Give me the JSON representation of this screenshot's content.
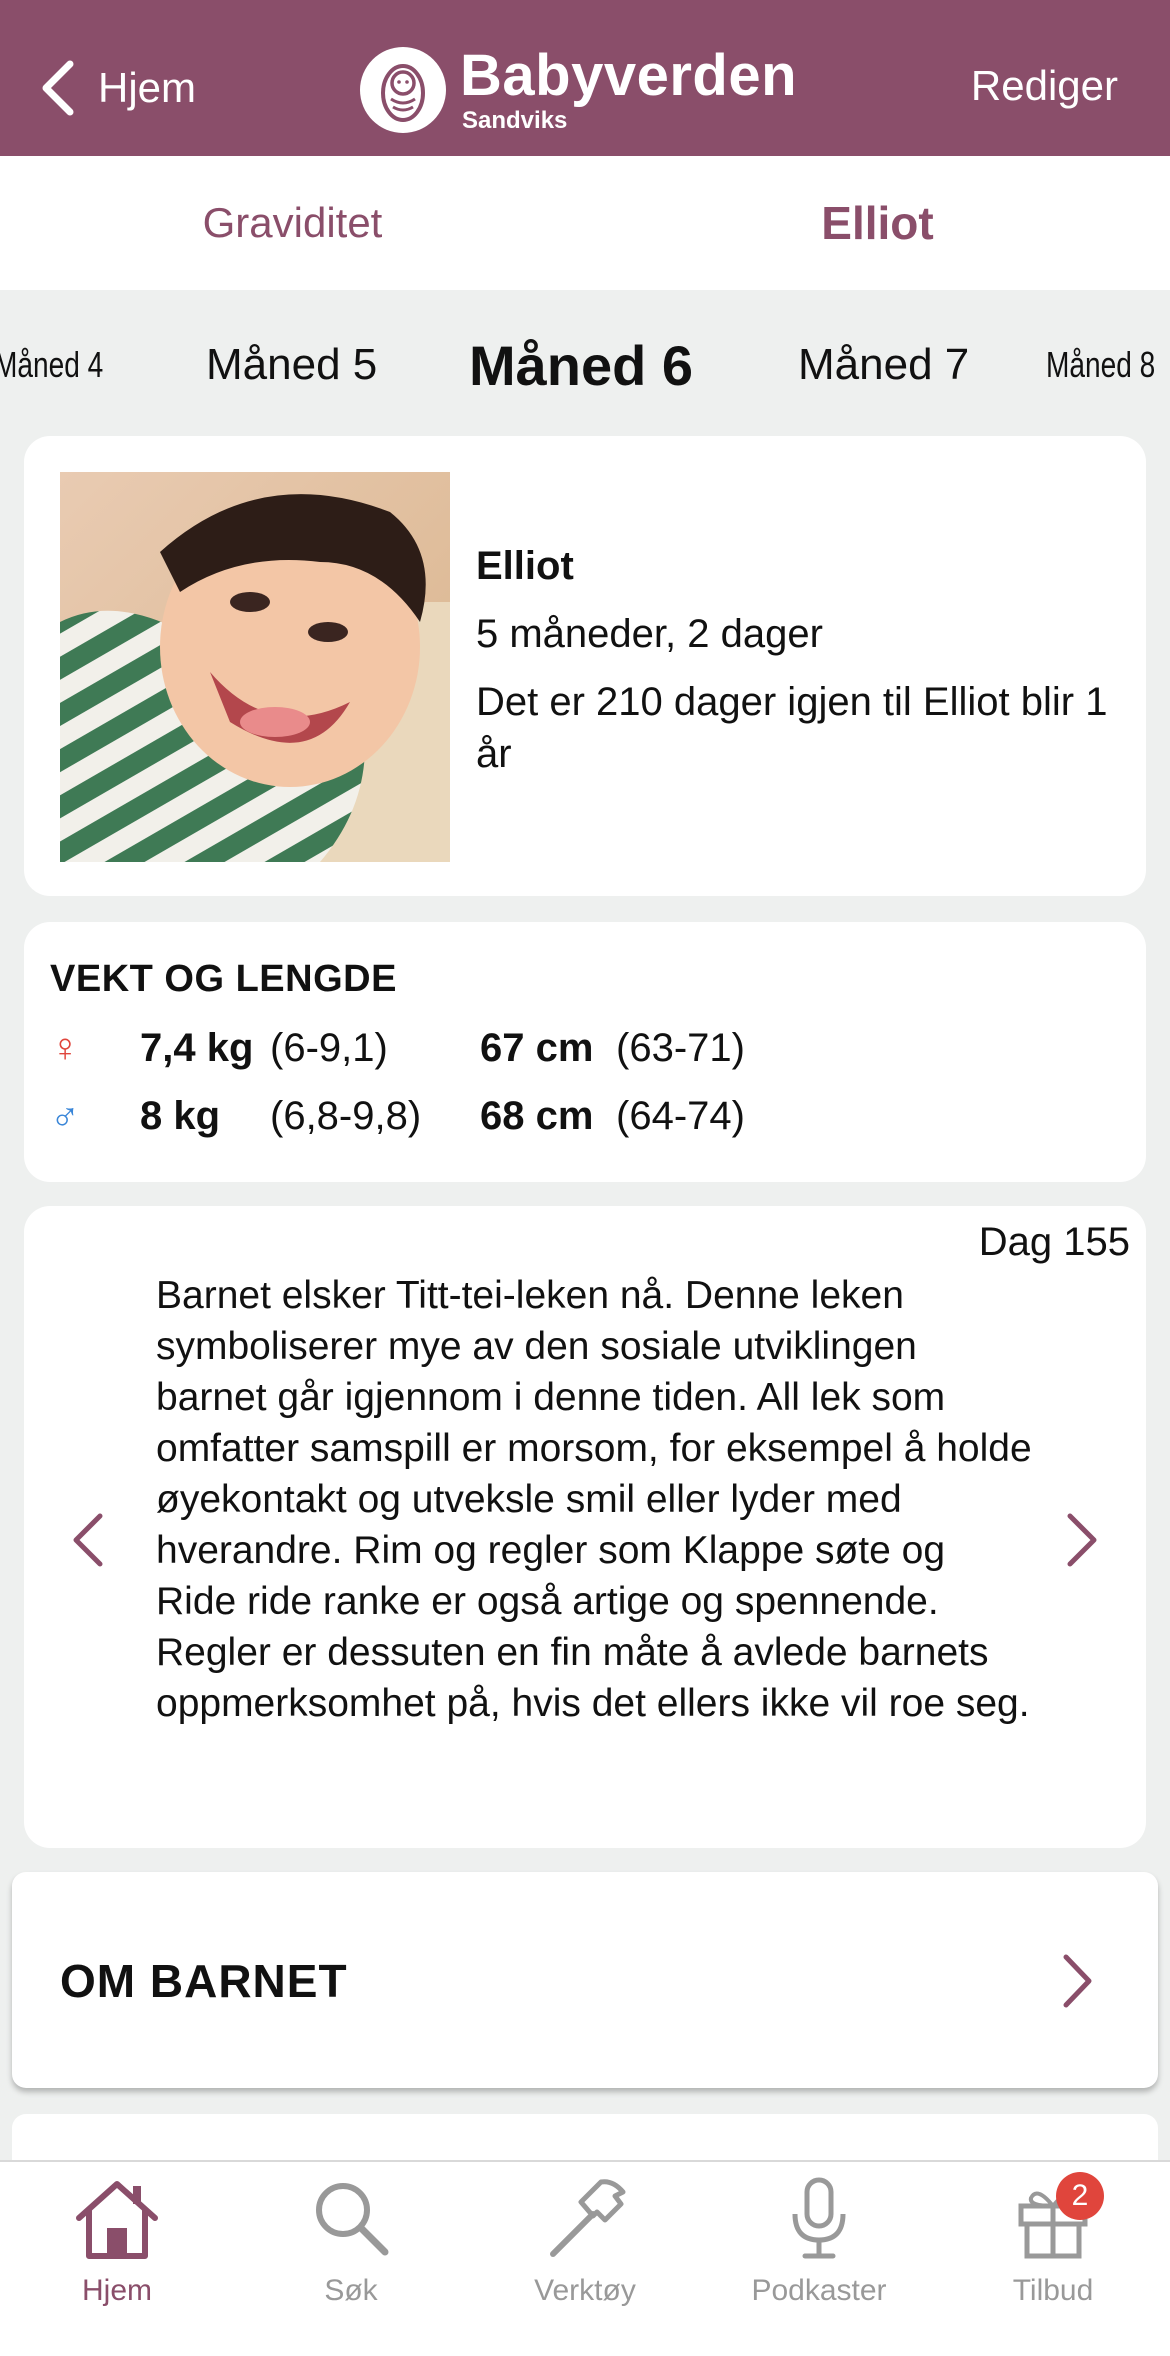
{
  "header": {
    "back_label": "Hjem",
    "brand_name": "Babyverden",
    "brand_sub": "Sandviks",
    "edit_label": "Rediger"
  },
  "segments": [
    {
      "label": "Graviditet",
      "active": false
    },
    {
      "label": "Elliot",
      "active": true
    }
  ],
  "months": {
    "far_prev": "Måned 4",
    "prev": "Måned 5",
    "current": "Måned 6",
    "next": "Måned 7",
    "far_next": "Måned 8"
  },
  "profile": {
    "name": "Elliot",
    "age": "5 måneder, 2 dager",
    "countdown": "Det er 210 dager igjen til Elliot blir 1 år"
  },
  "growth": {
    "title": "VEKT OG LENGDE",
    "girl": {
      "symbol": "♀",
      "weight": "7,4 kg",
      "weight_range": "(6-9,1)",
      "length": "67 cm",
      "length_range": "(63-71)"
    },
    "boy": {
      "symbol": "♂",
      "weight": "8 kg",
      "weight_range": "(6,8-9,8)",
      "length": "68 cm",
      "length_range": "(64-74)"
    }
  },
  "tip": {
    "day": "Dag 155",
    "text": "Barnet elsker Titt-tei-leken nå. Denne leken symboliserer mye av den sosiale utviklingen barnet går igjennom i denne tiden. All lek som omfatter samspill er morsom, for eksempel å holde øyekontakt og utveksle smil eller lyder med hverandre. Rim og regler som Klappe søte og Ride ride ranke er også artige og spennende. Regler er dessuten en fin måte å avlede barnets oppmerksomhet på, hvis det ellers ikke vil roe seg."
  },
  "about": {
    "label": "OM BARNET"
  },
  "tabbar": {
    "home": "Hjem",
    "search": "Søk",
    "tools": "Verktøy",
    "podcasts": "Podkaster",
    "offers": "Tilbud",
    "offers_badge": "2"
  },
  "colors": {
    "brand": "#8a4e6a",
    "girl": "#e0453c",
    "boy": "#3a86d8",
    "badge": "#e0453c"
  }
}
